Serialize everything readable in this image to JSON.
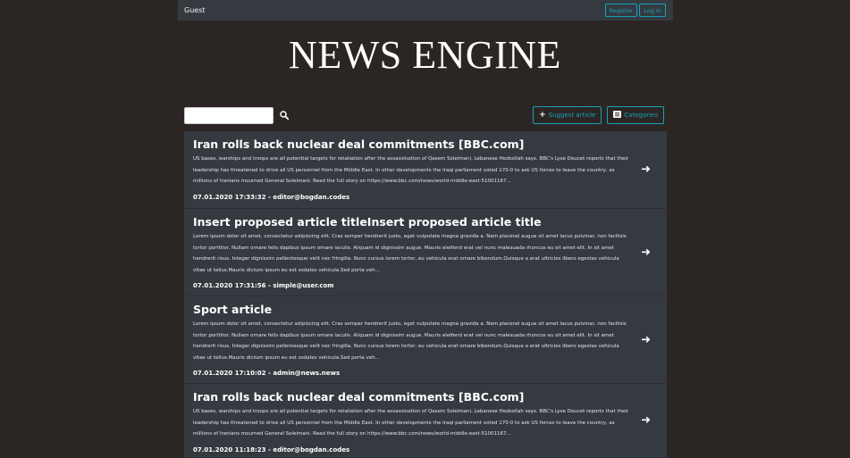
{
  "topbar": {
    "user": "Guest",
    "register_label": "Register",
    "login_label": "Log in"
  },
  "brand": "NEWS ENGINE",
  "search": {
    "value": "",
    "placeholder": "",
    "icon": "search-icon"
  },
  "actions": {
    "suggest_label": "Suggest article",
    "suggest_icon": "plus-icon",
    "categories_label": "Categories",
    "categories_icon": "list-icon"
  },
  "colors": {
    "accent": "#17a2b8",
    "panel": "#343a40",
    "background": "#2b2623"
  },
  "articles": [
    {
      "title": "Iran rolls back nuclear deal commitments [BBC.com]",
      "excerpt": "US bases, warships and troops are all potential targets for retaliation after the assassination of Qasem Soleimani, Lebanese Hezbollah says. BBC's Lyse Doucet reports that their leadership has threatened to drive all US personnel from the Middle East. In other developments the Iraqi parliament voted 170-0 to ask US forces to leave the country, as millions of Iranians mourned General Soleimani. Read the full story on https://www.bbc.com/news/world-middle-east-51001167...",
      "meta": "07.01.2020 17:33:32 - editor@bogdan.codes"
    },
    {
      "title": "Insert proposed article titleInsert proposed article title",
      "excerpt": "Lorem ipsum dolor sit amet, consectetur adipiscing elit. Cras semper hendrerit justo, eget vulputate magna gravida a. Nam placerat augue sit amet lacus pulvinar, non facilisis tortor porttitor. Nullam ornare felis dapibus ipsum ornare iaculis. Aliquam id dignissim augue. Mauris eleifend erat vel nunc malesuada rhoncus eu sit amet elit. In sit amet hendrerit risus. Integer dignissim pellentesque velit nec fringilla. Nunc cursus lorem tortor, eu vehicula erat ornare bibendum.Quisque a erat ultricies libero egestas vehicula vitae ut tellus.Mauris dictum ipsum eu est sodales vehicula.Sed porta veh...",
      "meta": "07.01.2020 17:31:56 - simple@user.com"
    },
    {
      "title": "Sport article",
      "excerpt": "Lorem ipsum dolor sit amet, consectetur adipiscing elit. Cras semper hendrerit justo, eget vulputate magna gravida a. Nam placerat augue sit amet lacus pulvinar, non facilisis tortor porttitor. Nullam ornare felis dapibus ipsum ornare iaculis. Aliquam id dignissim augue. Mauris eleifend erat vel nunc malesuada rhoncus eu sit amet elit. In sit amet hendrerit risus. Integer dignissim pellentesque velit nec fringilla. Nunc cursus lorem tortor, eu vehicula erat ornare bibendum.Quisque a erat ultricies libero egestas vehicula vitae ut tellus.Mauris dictum ipsum eu est sodales vehicula.Sed porta veh...",
      "meta": "07.01.2020 17:10:02 - admin@news.news"
    },
    {
      "title": "Iran rolls back nuclear deal commitments [BBC.com]",
      "excerpt": "US bases, warships and troops are all potential targets for retaliation after the assassination of Qasem Soleimani, Lebanese Hezbollah says. BBC's Lyse Doucet reports that their leadership has threatened to drive all US personnel from the Middle East. In other developments the Iraqi parliament voted 170-0 to ask US forces to leave the country, as millions of Iranians mourned General Soleimani. Read the full story on https://www.bbc.com/news/world-middle-east-51001167...",
      "meta": "07.01.2020 11:18:23 - editor@bogdan.codes"
    }
  ]
}
